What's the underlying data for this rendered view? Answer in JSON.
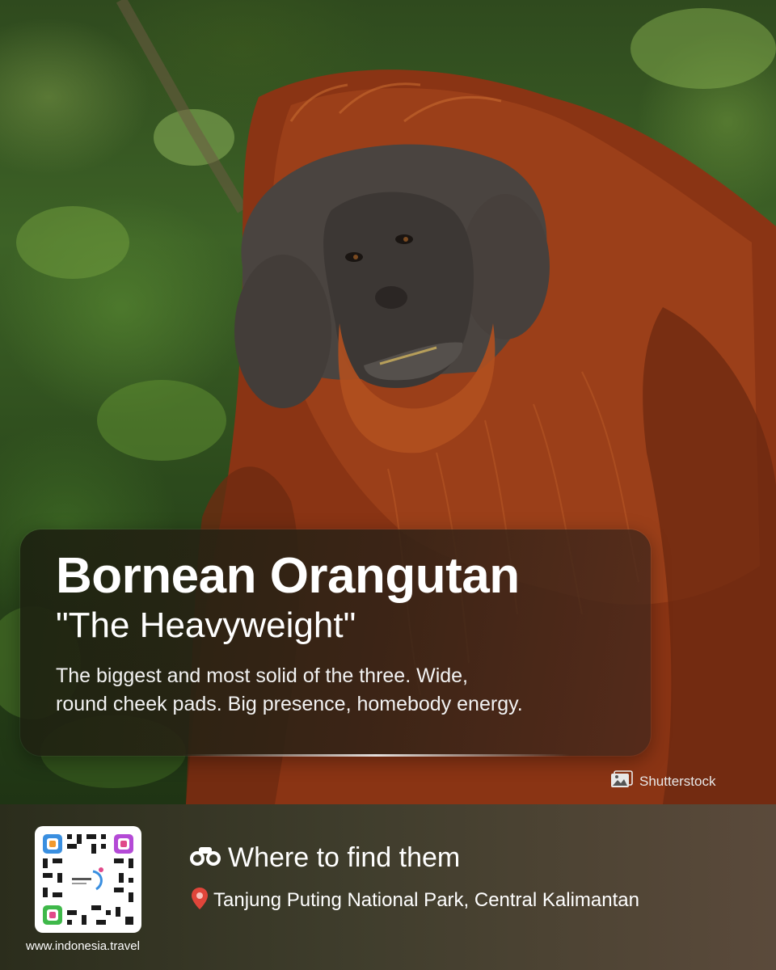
{
  "photo": {
    "subject": "orangutan-photo"
  },
  "card": {
    "title": "Bornean Orangutan",
    "subtitle": "\"The Heavyweight\"",
    "description_line1": "The biggest and most solid of the three. Wide,",
    "description_line2": "round cheek pads. Big presence, homebody energy."
  },
  "credit": {
    "label": "Shutterstock",
    "icon": "image-icon"
  },
  "footer": {
    "website": "www.indonesia.travel",
    "find_title": "Where to find them",
    "find_icon": "binoculars-icon",
    "location": "Tanjung Puting National Park, Central Kalimantan",
    "location_icon": "pin-icon"
  },
  "colors": {
    "fur": "#8a3414",
    "band_start": "#2b2d1c",
    "band_end": "#5b4a3b",
    "pin": "#e0453a"
  }
}
